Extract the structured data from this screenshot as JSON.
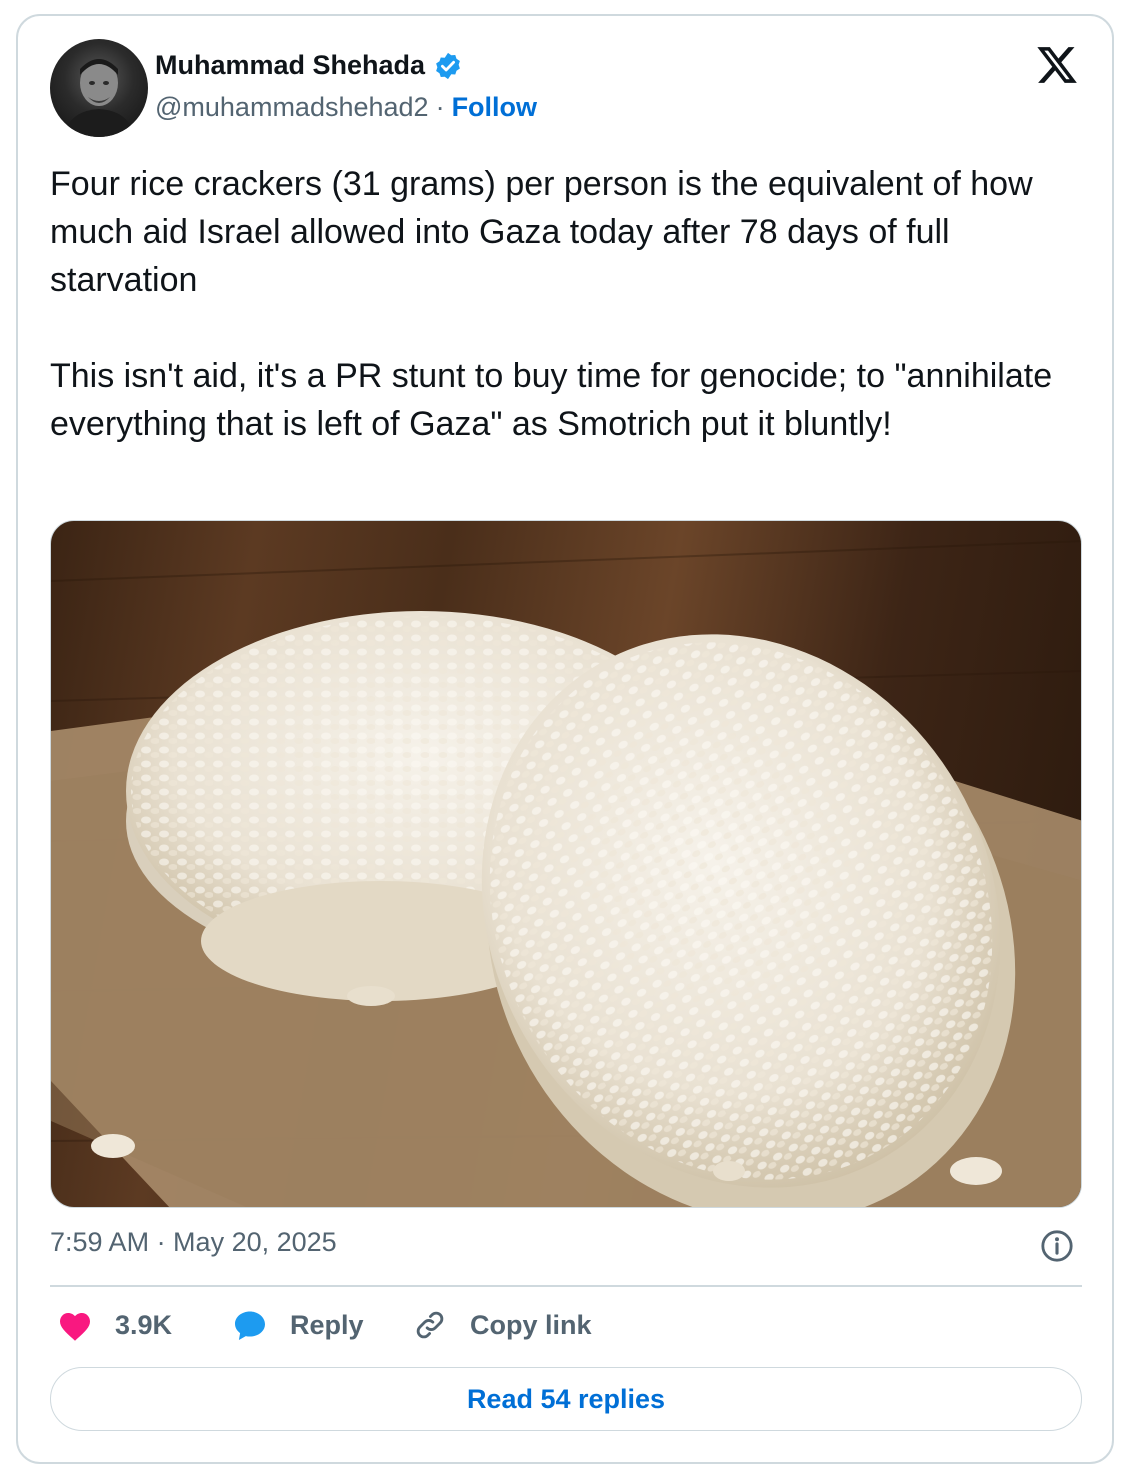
{
  "author": {
    "name": "Muhammad Shehada",
    "handle": "@muhammadshehad2",
    "separator": "·",
    "follow_label": "Follow",
    "verified_color": "#1d9bf0"
  },
  "tweet": {
    "paragraphs": [
      "Four rice crackers (31 grams) per person is the equivalent of how much aid Israel allowed into Gaza today after 78 days of full starvation",
      "This isn't aid, it's a PR stunt to buy time for genocide; to \"annihilate everything that is left of Gaza\" as Smotrich put it bluntly!"
    ],
    "timestamp": "7:59 AM · May 20, 2025"
  },
  "actions": {
    "likes": "3.9K",
    "reply_label": "Reply",
    "copy_label": "Copy link",
    "read_replies_label": "Read 54 replies"
  },
  "icons": {
    "platform_logo": "x-logo-icon",
    "like": "heart-icon",
    "reply": "speech-bubble-icon",
    "copy": "link-icon",
    "info": "info-icon"
  },
  "colors": {
    "heart": "#f91880",
    "reply_bubble": "#1d9bf0",
    "link_blue": "#006fd6",
    "muted_text": "#536471",
    "border": "#cfd9de"
  }
}
